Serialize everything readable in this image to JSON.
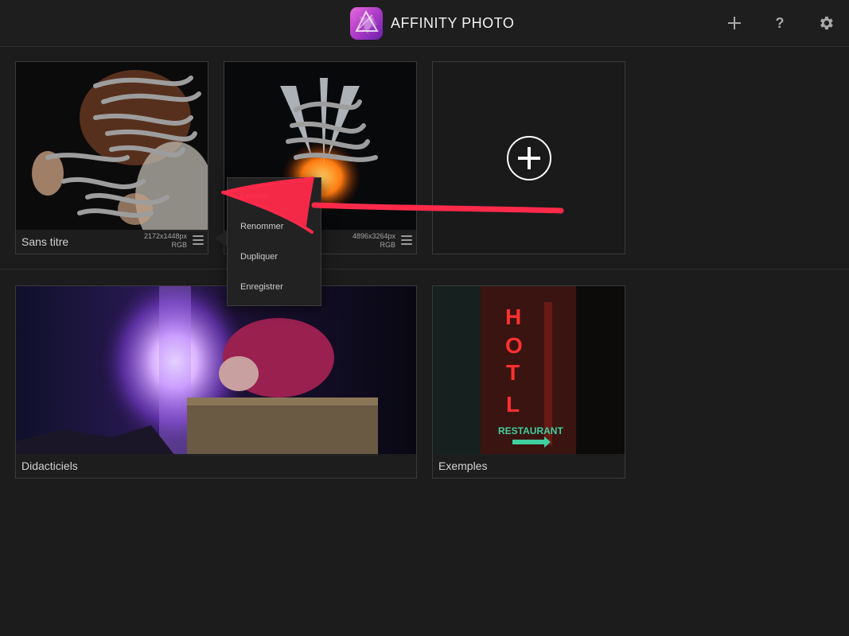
{
  "app": {
    "title": "AFFINITY PHOTO",
    "accent": "#b33fc9"
  },
  "toolbar": {
    "new_icon": "plus-icon",
    "help_label": "?",
    "settings_icon": "gear-icon"
  },
  "documents": [
    {
      "name": "Sans titre",
      "dimensions": "2172x1448px",
      "color_mode": "RGB"
    },
    {
      "name": "",
      "dimensions": "4896x3264px",
      "color_mode": "RGB"
    }
  ],
  "new_document": {
    "icon": "plus-circle-icon"
  },
  "context_menu": {
    "items": [
      "Fermer",
      "Renommer",
      "Dupliquer",
      "Enregistrer"
    ]
  },
  "sections": [
    {
      "label": "Didacticiels"
    },
    {
      "label": "Exemples"
    }
  ],
  "annotation": {
    "color": "#ff2a4a"
  }
}
